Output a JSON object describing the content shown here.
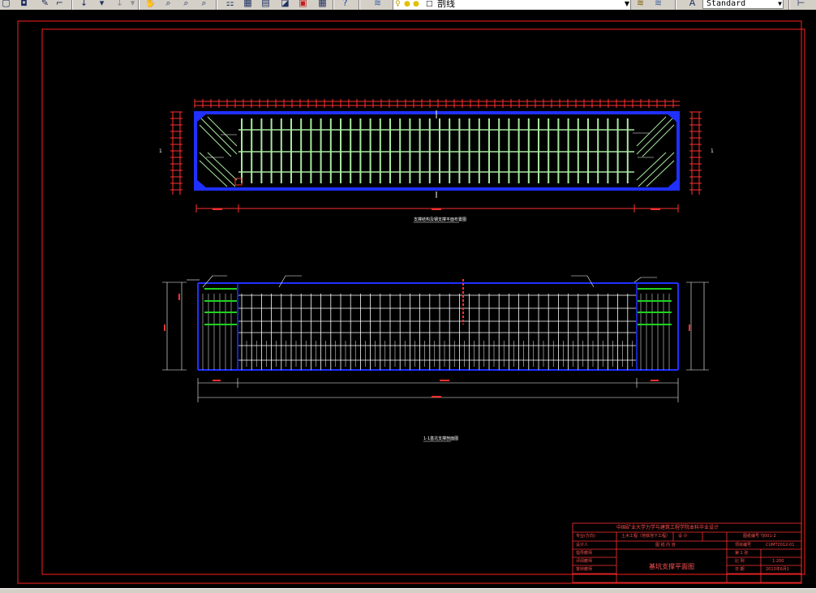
{
  "toolbar": {
    "icons": [
      "open-icon",
      "save-icon",
      "pencil-icon",
      "match-properties-icon",
      "undo-icon",
      "redo-icon",
      "pan-icon",
      "zoom-realtime-icon",
      "zoom-window-icon",
      "zoom-previous-icon",
      "properties-icon",
      "design-center-icon",
      "tool-palettes-icon",
      "sheetset-icon",
      "markup-icon",
      "calculator-icon",
      "help-icon",
      "layer-manager-icon"
    ],
    "layer_name": "剖线",
    "layer_state_icons": [
      "lightbulb-icon",
      "sun-icon",
      "lock-icon",
      "color-swatch-icon"
    ],
    "text_style": "Standard"
  },
  "drawing": {
    "plan_view_caption": "支撑结构及钢支撑平面布置图",
    "section_caption": "1-1基坑支撑剖面图",
    "colors": {
      "frame": "#ff2020",
      "structure_blue": "#2030ff",
      "brace_green": "#a8e8a0",
      "dimension_red": "#ff3030",
      "grid_white": "#ffffff",
      "accent_green": "#20d020"
    }
  },
  "title_block": {
    "header": "中国矿业大学力学与建筑工程学院本科毕业设计",
    "major_label": "专业(方向)",
    "major_value": "土木工程（地铁地下工程）",
    "row1_mid": "设  计",
    "row1_right": "图纸编号 TJ001-2",
    "designer": "设计人",
    "drawing_content_label": "图 纸 内 容",
    "project_no_label": "项目编号",
    "project_no_value": "CUMT2012-01",
    "advisor": "指导教师",
    "reviewer": "评阅教师",
    "defense": "答辩教师",
    "drawing_title": "基坑支撑平面图",
    "sheet_label": "第 1 张",
    "scale_label": "比  例",
    "scale_value": "1:200",
    "date_label": "日  期",
    "date_value": "2013年6月1"
  }
}
